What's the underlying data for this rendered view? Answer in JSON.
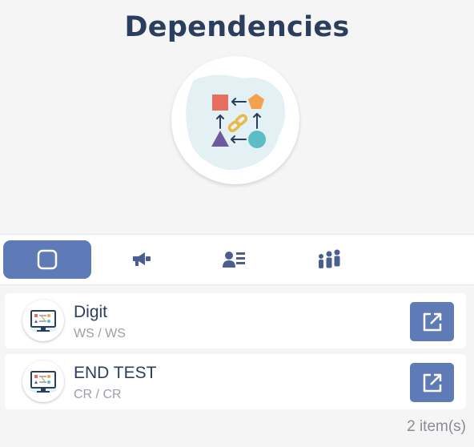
{
  "header": {
    "title": "Dependencies",
    "hero_icon": "dependency-shapes-icon"
  },
  "tabs": [
    {
      "icon": "square-icon",
      "active": true
    },
    {
      "icon": "megaphone-icon",
      "active": false
    },
    {
      "icon": "person-list-icon",
      "active": false
    },
    {
      "icon": "group-icon",
      "active": false
    }
  ],
  "items": [
    {
      "title": "Digit",
      "subtitle": "WS / WS",
      "icon": "monitor-diagram-icon",
      "action_icon": "external-link-icon"
    },
    {
      "title": "END TEST",
      "subtitle": "CR / CR",
      "icon": "monitor-diagram-icon",
      "action_icon": "external-link-icon"
    }
  ],
  "footer": {
    "count_text": "2 item(s)"
  },
  "colors": {
    "accent": "#5e7bb8",
    "title": "#2c3e5e",
    "muted": "#9aa0a8",
    "background": "#f5f5f5"
  }
}
